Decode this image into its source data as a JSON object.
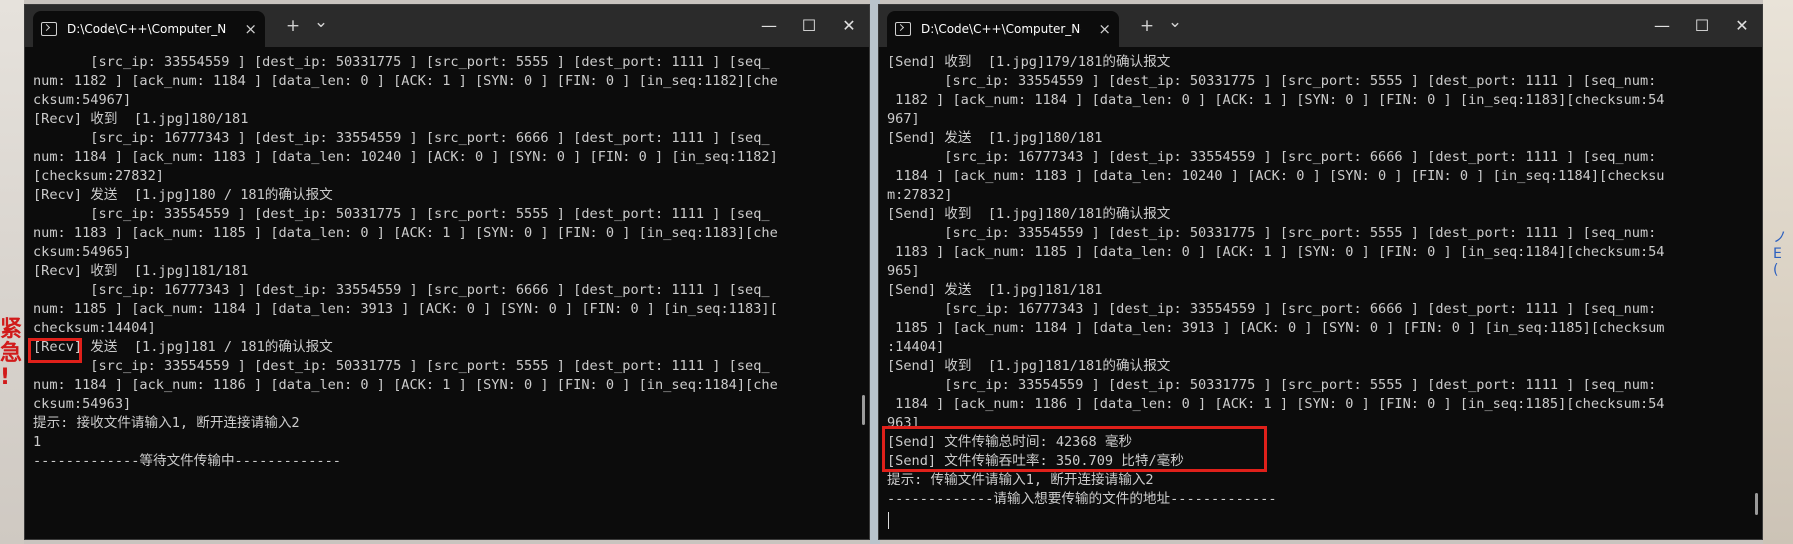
{
  "left_window": {
    "tab_title": "D:\\Code\\C++\\Computer_Network",
    "lines": [
      "       [src_ip: 33554559 ] [dest_ip: 50331775 ] [src_port: 5555 ] [dest_port: 1111 ] [seq_",
      "num: 1182 ] [ack_num: 1184 ] [data_len: 0 ] [ACK: 1 ] [SYN: 0 ] [FIN: 0 ] [in_seq:1182][che",
      "cksum:54967]",
      "[Recv] 收到  [1.jpg]180/181",
      "       [src_ip: 16777343 ] [dest_ip: 33554559 ] [src_port: 6666 ] [dest_port: 1111 ] [seq_",
      "num: 1184 ] [ack_num: 1183 ] [data_len: 10240 ] [ACK: 0 ] [SYN: 0 ] [FIN: 0 ] [in_seq:1182]",
      "[checksum:27832]",
      "[Recv] 发送  [1.jpg]180 / 181的确认报文",
      "       [src_ip: 33554559 ] [dest_ip: 50331775 ] [src_port: 5555 ] [dest_port: 1111 ] [seq_",
      "num: 1183 ] [ack_num: 1185 ] [data_len: 0 ] [ACK: 1 ] [SYN: 0 ] [FIN: 0 ] [in_seq:1183][che",
      "cksum:54965]",
      "[Recv] 收到  [1.jpg]181/181",
      "       [src_ip: 16777343 ] [dest_ip: 33554559 ] [src_port: 6666 ] [dest_port: 1111 ] [seq_",
      "num: 1185 ] [ack_num: 1184 ] [data_len: 3913 ] [ACK: 0 ] [SYN: 0 ] [FIN: 0 ] [in_seq:1183][",
      "checksum:14404]",
      "[Recv] 发送  [1.jpg]181 / 181的确认报文",
      "       [src_ip: 33554559 ] [dest_ip: 50331775 ] [src_port: 5555 ] [dest_port: 1111 ] [seq_",
      "num: 1184 ] [ack_num: 1186 ] [data_len: 0 ] [ACK: 1 ] [SYN: 0 ] [FIN: 0 ] [in_seq:1184][che",
      "cksum:54963]",
      "提示: 接收文件请输入1, 断开连接请输入2",
      "1",
      "-------------等待文件传输中-------------"
    ]
  },
  "right_window": {
    "tab_title": "D:\\Code\\C++\\Computer_Network",
    "lines": [
      "[Send] 收到  [1.jpg]179/181的确认报文",
      "       [src_ip: 33554559 ] [dest_ip: 50331775 ] [src_port: 5555 ] [dest_port: 1111 ] [seq_num:",
      " 1182 ] [ack_num: 1184 ] [data_len: 0 ] [ACK: 1 ] [SYN: 0 ] [FIN: 0 ] [in_seq:1183][checksum:54",
      "967]",
      "[Send] 发送  [1.jpg]180/181",
      "       [src_ip: 16777343 ] [dest_ip: 33554559 ] [src_port: 6666 ] [dest_port: 1111 ] [seq_num:",
      " 1184 ] [ack_num: 1183 ] [data_len: 10240 ] [ACK: 0 ] [SYN: 0 ] [FIN: 0 ] [in_seq:1184][checksu",
      "m:27832]",
      "[Send] 收到  [1.jpg]180/181的确认报文",
      "       [src_ip: 33554559 ] [dest_ip: 50331775 ] [src_port: 5555 ] [dest_port: 1111 ] [seq_num:",
      " 1183 ] [ack_num: 1185 ] [data_len: 0 ] [ACK: 1 ] [SYN: 0 ] [FIN: 0 ] [in_seq:1184][checksum:54",
      "965]",
      "[Send] 发送  [1.jpg]181/181",
      "       [src_ip: 16777343 ] [dest_ip: 33554559 ] [src_port: 6666 ] [dest_port: 1111 ] [seq_num:",
      " 1185 ] [ack_num: 1184 ] [data_len: 3913 ] [ACK: 0 ] [SYN: 0 ] [FIN: 0 ] [in_seq:1185][checksum",
      ":14404]",
      "[Send] 收到  [1.jpg]181/181的确认报文",
      "       [src_ip: 33554559 ] [dest_ip: 50331775 ] [src_port: 5555 ] [dest_port: 1111 ] [seq_num:",
      " 1184 ] [ack_num: 1186 ] [data_len: 0 ] [ACK: 1 ] [SYN: 0 ] [FIN: 0 ] [in_seq:1185][checksum:54",
      "963]",
      "[Send] 文件传输总时间: 42368 毫秒",
      "[Send] 文件传输吞吐率: 350.709 比特/毫秒",
      "提示: 传输文件请输入1, 断开连接请输入2",
      "-------------请输入想要传输的文件的地址-------------"
    ]
  },
  "tab_controls": {
    "new_tab": "+",
    "dropdown": "⌄",
    "close": "×"
  },
  "window_controls": {
    "minimize": "—",
    "maximize": "☐",
    "close": "✕"
  },
  "annotations": {
    "left_side_glyphs": "紧\n急\n!",
    "right_side_glyphs": "ノ\nE\n("
  },
  "colors": {
    "highlight": "#e0201a",
    "terminal_bg": "#0c0c0c",
    "terminal_text": "#cccccc"
  }
}
